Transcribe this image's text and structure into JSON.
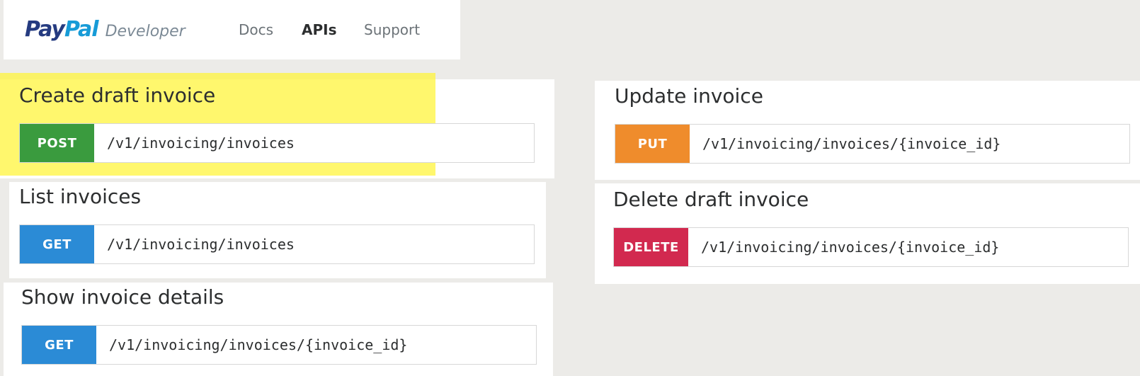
{
  "header": {
    "logo": {
      "pay": "Pay",
      "pal": "Pal",
      "developer": "Developer"
    },
    "nav": [
      {
        "label": "Docs",
        "active": false
      },
      {
        "label": "APIs",
        "active": true
      },
      {
        "label": "Support",
        "active": false
      }
    ]
  },
  "endpoints": [
    {
      "title": "Create draft invoice",
      "method": "POST",
      "path": "/v1/invoicing/invoices",
      "color": "#3a9b3e",
      "highlighted": true
    },
    {
      "title": "List invoices",
      "method": "GET",
      "path": "/v1/invoicing/invoices",
      "color": "#2b8bd6",
      "highlighted": false
    },
    {
      "title": "Show invoice details",
      "method": "GET",
      "path": "/v1/invoicing/invoices/{invoice_id}",
      "color": "#2b8bd6",
      "highlighted": false
    },
    {
      "title": "Update invoice",
      "method": "PUT",
      "path": "/v1/invoicing/invoices/{invoice_id}",
      "color": "#ef8c2c",
      "highlighted": false
    },
    {
      "title": "Delete draft invoice",
      "method": "DELETE",
      "path": "/v1/invoicing/invoices/{invoice_id}",
      "color": "#d2294f",
      "highlighted": false
    }
  ],
  "colors": {
    "background": "#ecebe8",
    "highlight": "#fff43c",
    "paypal_dark_blue": "#253b80",
    "paypal_light_blue": "#179bd7"
  }
}
